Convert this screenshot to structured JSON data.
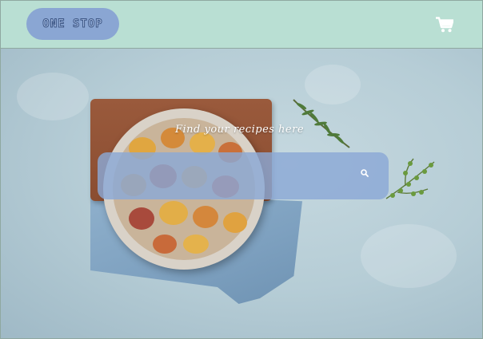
{
  "header": {
    "logo_text": "ONE STOP",
    "cart_icon": "shopping-cart-icon"
  },
  "hero": {
    "tagline": "Find your recipes here",
    "search": {
      "value": "",
      "placeholder": "",
      "icon": "search-icon"
    }
  },
  "colors": {
    "header_bg": "#b9dfd3",
    "logo_pill": "#8aa6d3",
    "search_bar": "#8ba8d6",
    "hero_bg": "#b6cdd6"
  }
}
